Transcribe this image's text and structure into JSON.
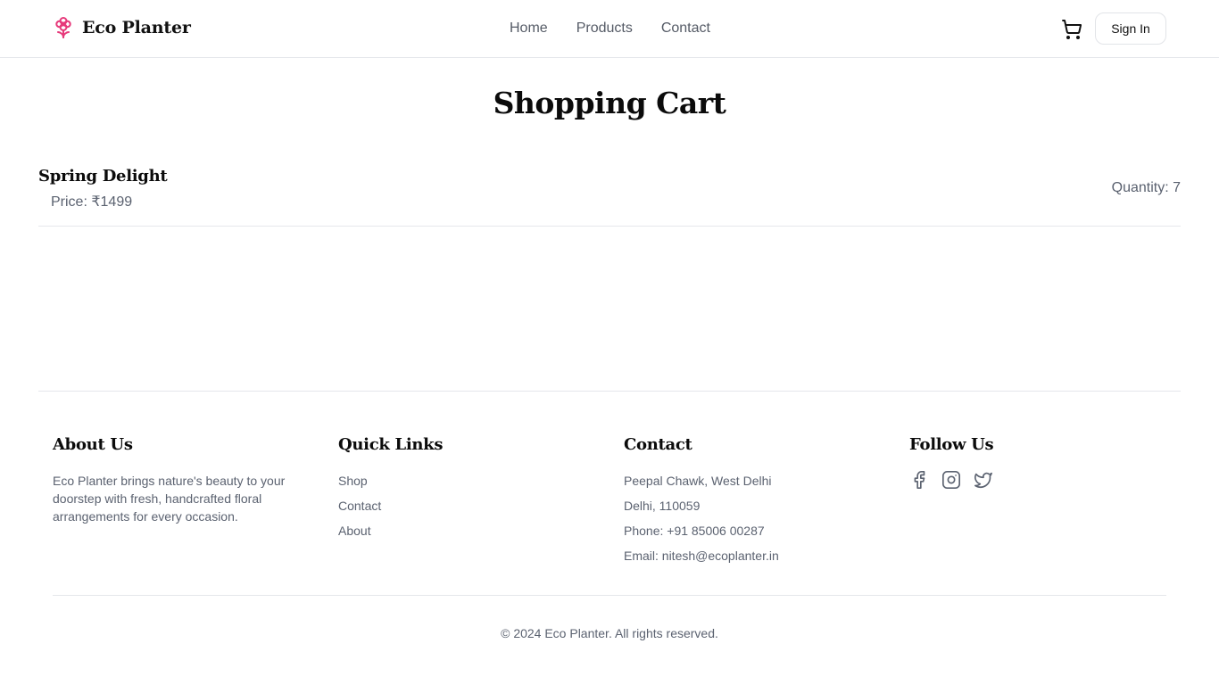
{
  "brand": {
    "name": "Eco Planter",
    "icon": "flower-icon",
    "accent": "#e6397a"
  },
  "nav": {
    "home": "Home",
    "products": "Products",
    "contact": "Contact"
  },
  "header": {
    "cart_icon": "shopping-cart-icon",
    "signin_label": "Sign In"
  },
  "page": {
    "title": "Shopping Cart"
  },
  "cart": {
    "items": [
      {
        "name": "Spring Delight",
        "price_text": "Price: ₹1499",
        "quantity_text": "Quantity: 7"
      }
    ]
  },
  "footer": {
    "about": {
      "heading": "About Us",
      "text": "Eco Planter brings nature's beauty to your doorstep with fresh, handcrafted floral arrangements for every occasion."
    },
    "quick_links": {
      "heading": "Quick Links",
      "items": [
        "Shop",
        "Contact",
        "About"
      ]
    },
    "contact": {
      "heading": "Contact",
      "lines": [
        "Peepal Chawk, West Delhi",
        "Delhi, 110059",
        "Phone: +91 85006 00287",
        "Email: nitesh@ecoplanter.in"
      ]
    },
    "follow": {
      "heading": "Follow Us",
      "icons": [
        "facebook-icon",
        "instagram-icon",
        "twitter-icon"
      ]
    },
    "copyright": "© 2024 Eco Planter. All rights reserved."
  }
}
